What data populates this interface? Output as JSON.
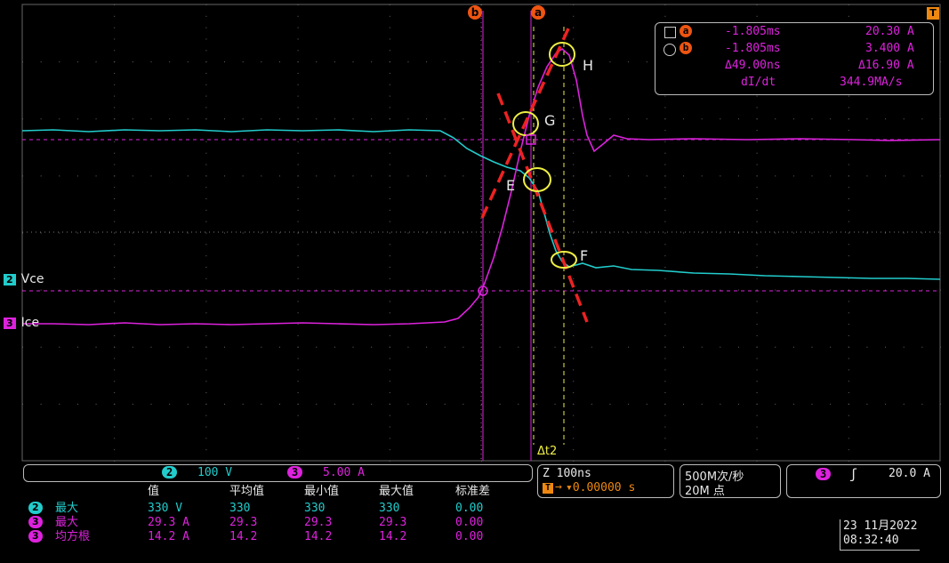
{
  "cursors": {
    "b_label": "b",
    "a_label": "a",
    "trigger_label": "T"
  },
  "channels": {
    "ch2": {
      "num": "2",
      "name": "Vce",
      "color": "#22cccc",
      "scale": "100 V"
    },
    "ch3": {
      "num": "3",
      "name": "Ice",
      "color": "#dd22dd",
      "scale": "5.00 A"
    }
  },
  "cursor_readout": {
    "a_time": "-1.805ms",
    "a_val": "20.30 A",
    "b_time": "-1.805ms",
    "b_val": "3.400 A",
    "delta_time": "Δ49.00ns",
    "delta_val": "Δ16.90 A",
    "dildt_label": "dI/dt",
    "dildt_val": "344.9MA/s"
  },
  "annotations": {
    "H": "H",
    "G": "G",
    "E": "E",
    "F": "F",
    "dt2": "Δt2"
  },
  "timebase": {
    "scale": "Z 100ns",
    "offset": "▾0.00000 s"
  },
  "acquisition": {
    "rate": "500M次/秒",
    "points": "20M 点"
  },
  "trigger": {
    "channel": "3",
    "level": "20.0 A"
  },
  "datetime": {
    "date": "23 11月2022",
    "time": "08:32:40"
  },
  "measurements": {
    "headers": [
      "值",
      "平均值",
      "最小值",
      "最大值",
      "标准差"
    ],
    "rows": [
      {
        "ch": "2",
        "label": "最大",
        "value": "330 V",
        "mean": "330",
        "min": "330",
        "max": "330",
        "std": "0.00"
      },
      {
        "ch": "3",
        "label": "最大",
        "value": "29.3 A",
        "mean": "29.3",
        "min": "29.3",
        "max": "29.3",
        "std": "0.00"
      },
      {
        "ch": "3",
        "label": "均方根",
        "value": "14.2 A",
        "mean": "14.2",
        "min": "14.2",
        "max": "14.2",
        "std": "0.00"
      }
    ]
  }
}
